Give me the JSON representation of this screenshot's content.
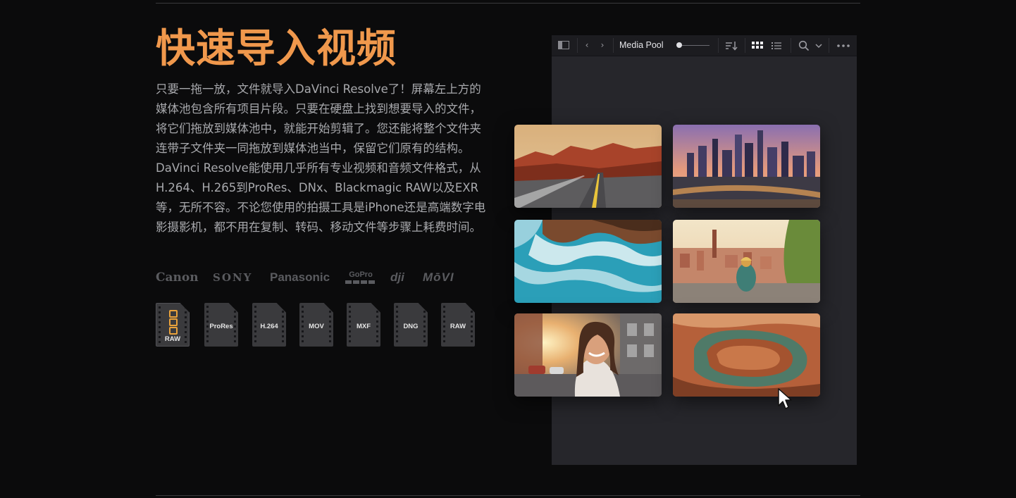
{
  "section": {
    "title": "快速导入视频",
    "description": "只要一拖一放，文件就导入DaVinci Resolve了！屏幕左上方的媒体池包含所有项目片段。只要在硬盘上找到想要导入的文件，将它们拖放到媒体池中，就能开始剪辑了。您还能将整个文件夹连带子文件夹一同拖放到媒体池当中，保留它们原有的结构。DaVinci Resolve能使用几乎所有专业视频和音频文件格式，从H.264、H.265到ProRes、DNx、Blackmagic RAW以及EXR等，无所不容。不论您使用的拍摄工具是iPhone还是高端数字电影摄影机，都不用在复制、转码、移动文件等步骤上耗费时间。"
  },
  "brands": [
    "Canon",
    "SONY",
    "Panasonic",
    "GoPro",
    "dji",
    "MōVI"
  ],
  "formats": [
    "RAW",
    "ProRes",
    "H.264",
    "MOV",
    "MXF",
    "DNG",
    "RAW"
  ],
  "media_pool": {
    "label": "Media Pool",
    "icons": [
      "sidebar-toggle-icon",
      "chevron-left-icon",
      "chevron-right-icon",
      "zoom-slider",
      "sort-icon",
      "grid-view-icon",
      "list-view-icon",
      "search-icon",
      "chevron-down-icon",
      "more-options-icon"
    ],
    "zoom_level": 0.0,
    "clips": [
      {
        "subject": "desert-road",
        "selected": false
      },
      {
        "subject": "city-skyline-sunset",
        "selected": false
      },
      {
        "subject": "ocean-rocks-aerial",
        "selected": false
      },
      {
        "subject": "traveler-overlooking-city",
        "selected": false
      },
      {
        "subject": "street-selfie",
        "selected": false
      },
      {
        "subject": "canyon-river-bend",
        "selected": false
      }
    ]
  },
  "colors": {
    "accent": "#f0984c",
    "background": "#0b0b0c",
    "body_text": "#a8a9ad",
    "panel": "#26262b",
    "raw_badge": "#e9a23b"
  }
}
